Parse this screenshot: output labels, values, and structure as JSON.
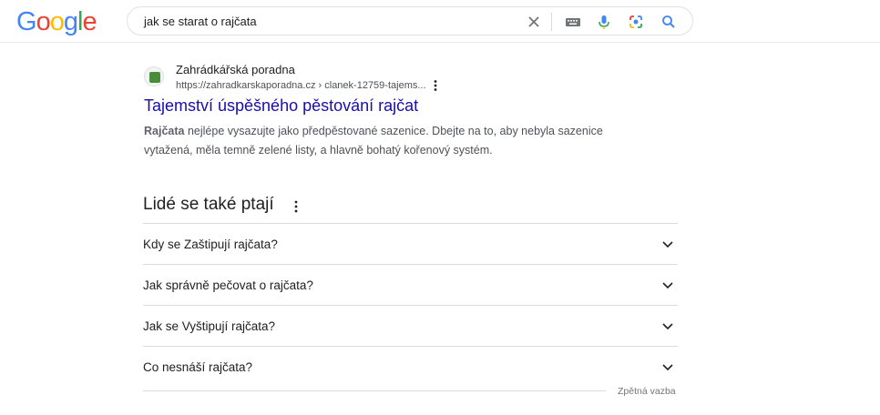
{
  "header": {
    "logo_letters": [
      {
        "char": "G",
        "color": "#4285F4"
      },
      {
        "char": "o",
        "color": "#EA4335"
      },
      {
        "char": "o",
        "color": "#FBBC05"
      },
      {
        "char": "g",
        "color": "#4285F4"
      },
      {
        "char": "l",
        "color": "#34A853"
      },
      {
        "char": "e",
        "color": "#EA4335"
      }
    ],
    "search_query": "jak se starat o rajčata",
    "icons": [
      "close-icon",
      "keyboard-icon",
      "microphone-icon",
      "google-lens-icon",
      "search-icon"
    ]
  },
  "result": {
    "site_name": "Zahrádkářská poradna",
    "url": "https://zahradkarskaporadna.cz › clanek-12759-tajems...",
    "title": "Tajemství úspěšného pěstování rajčat",
    "snippet_bold": "Rajčata",
    "snippet_rest": " nejlépe vysazujte jako předpěstované sazenice. Dbejte na to, aby nebyla sazenice vytažená, měla temně zelené listy, a hlavně bohatý kořenový systém."
  },
  "people_also_ask": {
    "heading": "Lidé se také ptají",
    "questions": [
      "Kdy se Zaštipují rajčata?",
      "Jak správně pečovat o rajčata?",
      "Jak se Vyštipují rajčata?",
      "Co nesnáší rajčata?"
    ],
    "feedback_label": "Zpětná vazba"
  },
  "colors": {
    "link": "#1a0dab",
    "text": "#202124",
    "secondary_text": "#4d5156",
    "divider": "#dadce0"
  }
}
